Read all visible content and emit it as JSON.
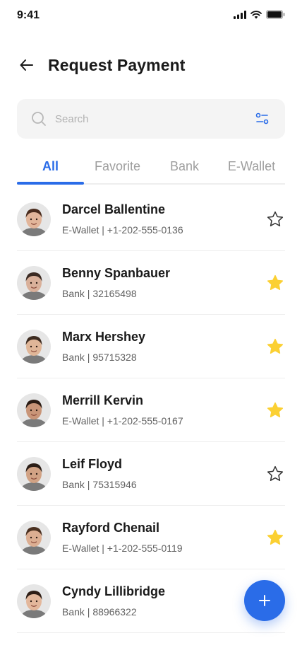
{
  "status_bar": {
    "time": "9:41"
  },
  "header": {
    "title": "Request Payment"
  },
  "search": {
    "placeholder": "Search"
  },
  "tabs": [
    {
      "label": "All",
      "active": true
    },
    {
      "label": "Favorite",
      "active": false
    },
    {
      "label": "Bank",
      "active": false
    },
    {
      "label": "E-Wallet",
      "active": false
    }
  ],
  "contacts": [
    {
      "name": "Darcel Ballentine",
      "detail": "E-Wallet | +1-202-555-0136",
      "favorite": false,
      "skin": "#e2b59a",
      "hair": "#4a2c1e"
    },
    {
      "name": "Benny Spanbauer",
      "detail": "Bank | 32165498",
      "favorite": true,
      "skin": "#d9b09a",
      "hair": "#3a2a22"
    },
    {
      "name": "Marx Hershey",
      "detail": "Bank | 95715328",
      "favorite": true,
      "skin": "#e0b698",
      "hair": "#3d2b20"
    },
    {
      "name": "Merrill Kervin",
      "detail": "E-Wallet | +1-202-555-0167",
      "favorite": true,
      "skin": "#c99578",
      "hair": "#2b1c14"
    },
    {
      "name": "Leif Floyd",
      "detail": "Bank | 75315946",
      "favorite": false,
      "skin": "#d1a284",
      "hair": "#2a1d16"
    },
    {
      "name": "Rayford Chenail",
      "detail": "E-Wallet | +1-202-555-0119",
      "favorite": true,
      "skin": "#dcae92",
      "hair": "#4a3020"
    },
    {
      "name": "Cyndy Lillibridge",
      "detail": "Bank | 88966322",
      "favorite": false,
      "skin": "#e3b79b",
      "hair": "#2e1e16"
    }
  ],
  "colors": {
    "accent": "#2a6ce8",
    "star_filled": "#fbd033",
    "star_outline": "#333333"
  },
  "icons": {
    "back": "arrow-left-icon",
    "search": "search-icon",
    "filter": "filter-icon",
    "star": "star-icon",
    "add": "plus-icon"
  }
}
